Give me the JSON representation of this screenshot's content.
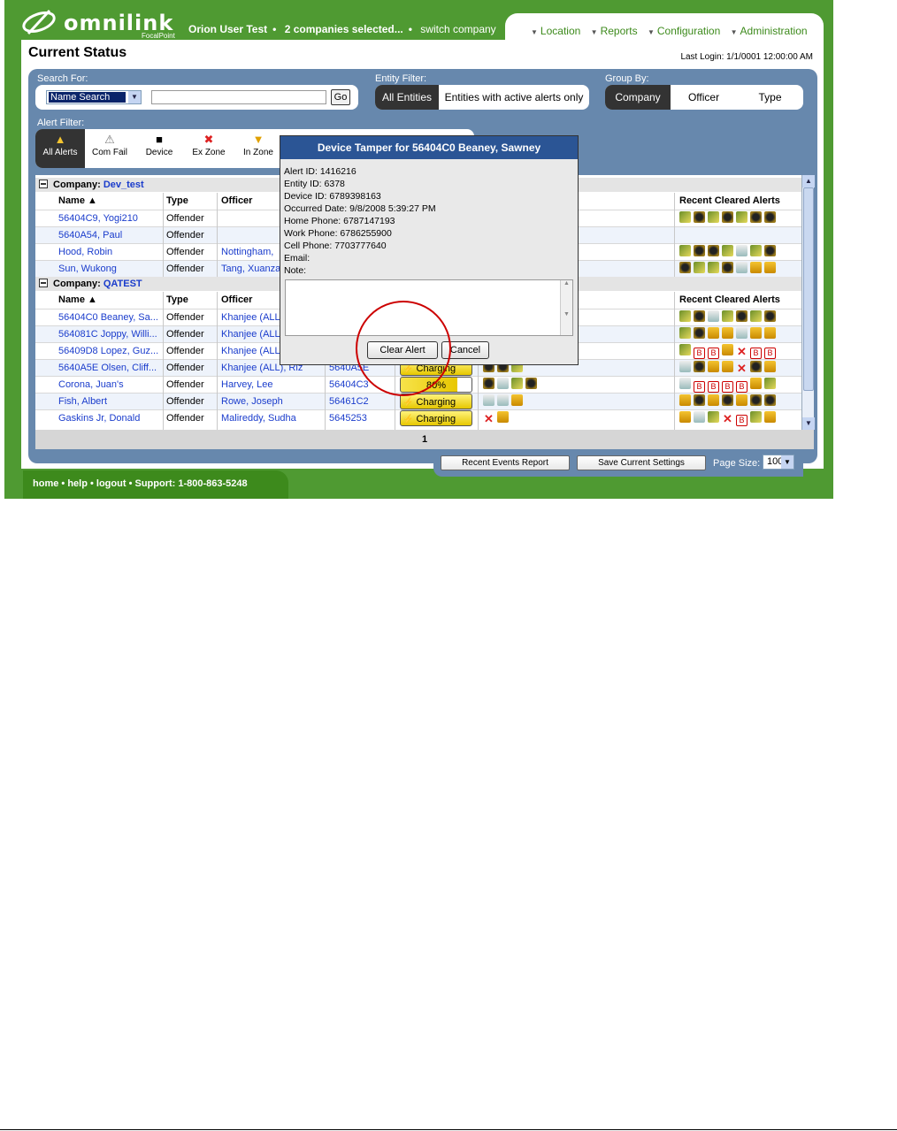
{
  "brand": {
    "name": "omnilink",
    "product": "FocalPoint"
  },
  "top_bar": {
    "user": "Orion User Test",
    "companies": "2 companies selected...",
    "switch_link": "switch company"
  },
  "nav": [
    "Location",
    "Reports",
    "Configuration",
    "Administration"
  ],
  "page": {
    "title": "Current Status",
    "last_login": "Last Login: 1/1/0001 12:00:00 AM"
  },
  "search": {
    "label": "Search For:",
    "select_value": "Name Search",
    "input_value": "",
    "go_label": "Go"
  },
  "entity_filter": {
    "label": "Entity Filter:",
    "options": [
      "All Entities",
      "Entities with active alerts only"
    ],
    "selected": "All Entities"
  },
  "group_by": {
    "label": "Group By:",
    "options": [
      "Company",
      "Officer",
      "Type"
    ],
    "selected": "Company"
  },
  "alert_filter": {
    "label": "Alert Filter:",
    "items": [
      "All Alerts",
      "Com Fail",
      "Device",
      "Ex Zone",
      "In Zone"
    ]
  },
  "grid": {
    "columns": {
      "name": "Name",
      "type": "Type",
      "officer": "Officer",
      "recent": "Recent Cleared Alerts"
    },
    "sort_indicator": "▲",
    "companies": [
      {
        "label": "Company:",
        "name": "Dev_test",
        "rows": [
          {
            "name": "56404C9, Yogi210",
            "type": "Offender",
            "officer": "",
            "device": "",
            "battery": ""
          },
          {
            "name": "5640A54, Paul",
            "type": "Offender",
            "officer": "",
            "device": "",
            "battery": ""
          },
          {
            "name": "Hood, Robin",
            "type": "Offender",
            "officer": "Nottingham,",
            "device": "",
            "battery": ""
          },
          {
            "name": "Sun, Wukong",
            "type": "Offender",
            "officer": "Tang, Xuanza",
            "device": "",
            "battery": ""
          }
        ]
      },
      {
        "label": "Company:",
        "name": "QATEST",
        "rows": [
          {
            "name": "56404C0 Beaney, Sa...",
            "type": "Offender",
            "officer": "Khanjee (ALL",
            "device": "",
            "battery": ""
          },
          {
            "name": "564081C Joppy, Willi...",
            "type": "Offender",
            "officer": "Khanjee (ALL",
            "device": "",
            "battery": ""
          },
          {
            "name": "56409D8 Lopez, Guz...",
            "type": "Offender",
            "officer": "Khanjee (ALL",
            "device": "",
            "battery": ""
          },
          {
            "name": "5640A5E Olsen, Cliff...",
            "type": "Offender",
            "officer": "Khanjee (ALL), Riz",
            "device": "5640A5E",
            "battery": "Charging"
          },
          {
            "name": "Corona, Juan's",
            "type": "Offender",
            "officer": "Harvey, Lee",
            "device": "56404C3",
            "battery": "80%"
          },
          {
            "name": "Fish, Albert",
            "type": "Offender",
            "officer": "Rowe, Joseph",
            "device": "56461C2",
            "battery": "Charging"
          },
          {
            "name": "Gaskins Jr, Donald",
            "type": "Offender",
            "officer": "Malireddy, Sudha",
            "device": "5645253",
            "battery": "Charging"
          }
        ]
      }
    ]
  },
  "pager": {
    "current": "1"
  },
  "bottom": {
    "recent_events": "Recent Events Report",
    "save_settings": "Save Current Settings",
    "page_size_label": "Page Size:",
    "page_size": "100"
  },
  "footer": {
    "links": [
      "home",
      "help",
      "logout"
    ],
    "support": "Support: 1-800-863-5248"
  },
  "dialog": {
    "title": "Device Tamper for 56404C0 Beaney, Sawney",
    "fields": [
      "Alert ID: 1416216",
      "Entity ID: 6378",
      "Device ID: 6789398163",
      "Occurred Date: 9/8/2008 5:39:27 PM",
      "Home Phone: 6787147193",
      "Work Phone: 6786255900",
      "Cell Phone: 7703777640",
      "Email:",
      "Note:"
    ],
    "note_value": "",
    "clear_label": "Clear Alert",
    "cancel_label": "Cancel"
  }
}
